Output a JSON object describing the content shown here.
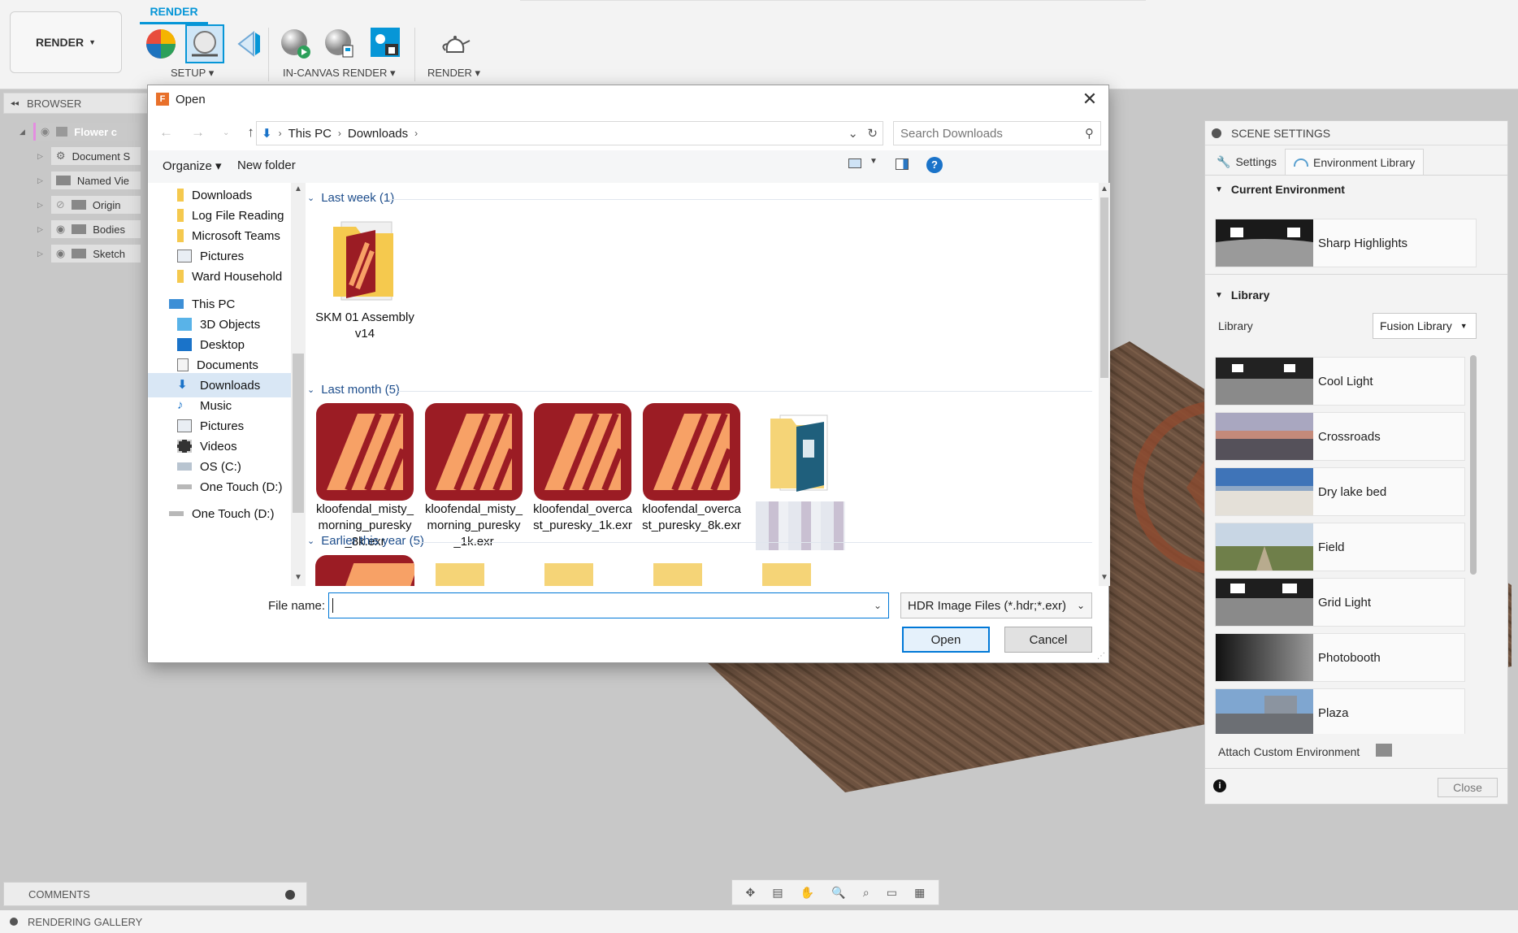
{
  "ribbon": {
    "workspace_label": "RENDER",
    "active_tab": "RENDER",
    "groups": [
      {
        "label": "SETUP ▾"
      },
      {
        "label": "IN-CANVAS RENDER ▾"
      },
      {
        "label": "RENDER ▾"
      }
    ]
  },
  "browser": {
    "title": "BROWSER",
    "items": [
      {
        "label": "Flower c"
      },
      {
        "label": "Document S"
      },
      {
        "label": "Named Vie"
      },
      {
        "label": "Origin"
      },
      {
        "label": "Bodies"
      },
      {
        "label": "Sketch"
      }
    ]
  },
  "bottom": {
    "comments_label": "COMMENTS",
    "gallery_label": "RENDERING GALLERY"
  },
  "scene_settings": {
    "title": "SCENE SETTINGS",
    "tabs": [
      {
        "label": "Settings"
      },
      {
        "label": "Environment Library"
      }
    ],
    "current_environment_title": "Current Environment",
    "current_environment": "Sharp Highlights",
    "library_title": "Library",
    "library_label": "Library",
    "library_select": "Fusion Library",
    "environments": [
      {
        "name": "Cool Light"
      },
      {
        "name": "Crossroads"
      },
      {
        "name": "Dry lake bed"
      },
      {
        "name": "Field"
      },
      {
        "name": "Grid Light"
      },
      {
        "name": "Photobooth"
      },
      {
        "name": "Plaza"
      }
    ],
    "attach_label": "Attach Custom Environment",
    "close_label": "Close"
  },
  "dialog": {
    "title": "Open",
    "breadcrumb": [
      "This PC",
      "Downloads"
    ],
    "search_placeholder": "Search Downloads",
    "organize_label": "Organize ▾",
    "new_folder_label": "New folder",
    "nav_items": [
      {
        "label": "Downloads"
      },
      {
        "label": "Log File Reading"
      },
      {
        "label": "Microsoft Teams"
      },
      {
        "label": "Pictures"
      },
      {
        "label": "Ward Household"
      },
      {
        "label": "This PC"
      },
      {
        "label": "3D Objects"
      },
      {
        "label": "Desktop"
      },
      {
        "label": "Documents"
      },
      {
        "label": "Downloads"
      },
      {
        "label": "Music"
      },
      {
        "label": "Pictures"
      },
      {
        "label": "Videos"
      },
      {
        "label": "OS (C:)"
      },
      {
        "label": "One Touch (D:)"
      },
      {
        "label": "One Touch (D:)"
      }
    ],
    "groups": [
      {
        "label": "Last week (1)"
      },
      {
        "label": "Last month (5)"
      },
      {
        "label": "Earlier this year (5)"
      }
    ],
    "files_last_week": [
      {
        "name": "SKM 01 Assembly v14"
      }
    ],
    "files_last_month": [
      {
        "name": "kloofendal_misty_morning_puresky_8k.exr"
      },
      {
        "name": "kloofendal_misty_morning_puresky_1k.exr"
      },
      {
        "name": "kloofendal_overcast_puresky_1k.exr"
      },
      {
        "name": "kloofendal_overcast_puresky_8k.exr"
      }
    ],
    "file_name_label": "File name:",
    "file_name_value": "",
    "file_type": "HDR Image Files (*.hdr;*.exr)",
    "open_label": "Open",
    "cancel_label": "Cancel"
  },
  "colors": {
    "accent": "#0696d7",
    "affinity_red": "#9b1c24",
    "affinity_orange": "#f7a166",
    "folder_yellow": "#f5c94e"
  }
}
